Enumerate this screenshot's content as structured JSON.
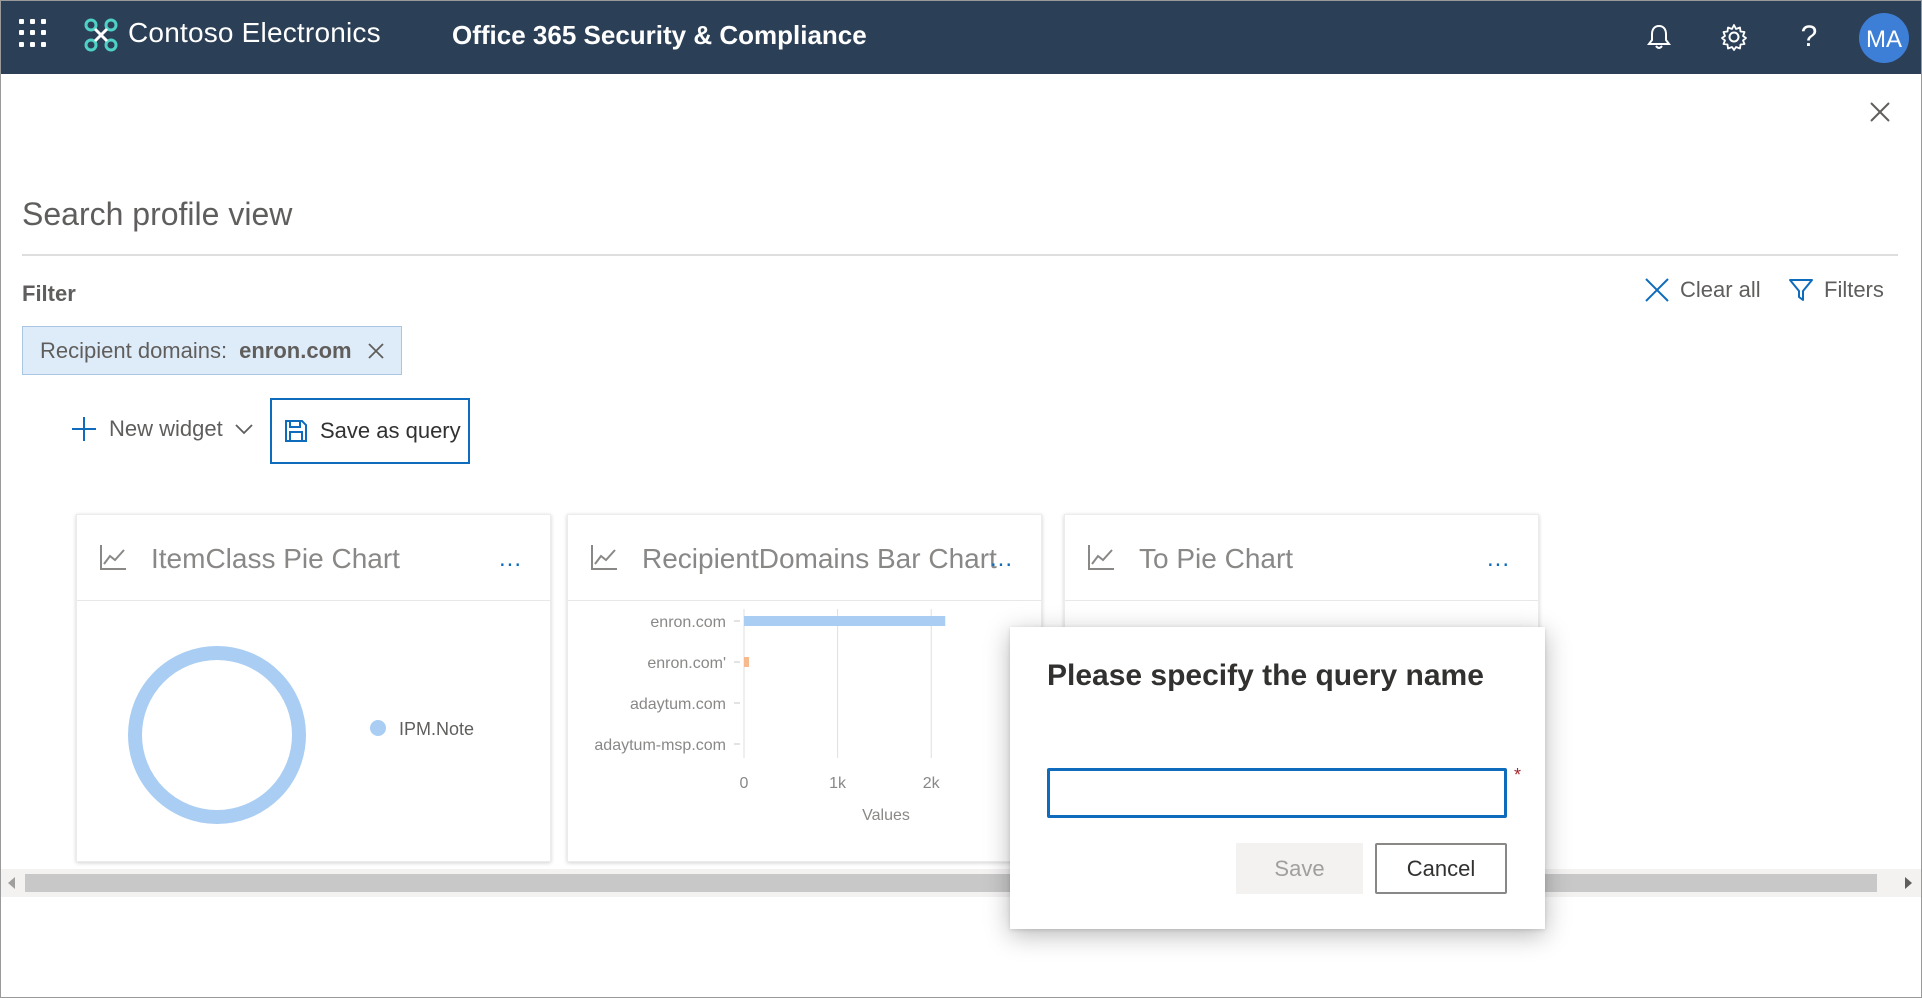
{
  "topbar": {
    "org_name": "Contoso Electronics",
    "app_title": "Office 365 Security & Compliance",
    "help_glyph": "?",
    "avatar_initials": "MA",
    "icons": [
      "app-launcher-icon",
      "bell-icon",
      "gear-icon",
      "help-icon"
    ]
  },
  "page": {
    "title": "Search profile view",
    "filter_label": "Filter",
    "clear_all_label": "Clear all",
    "filters_label": "Filters"
  },
  "filter_chip": {
    "label": "Recipient domains:",
    "value": "enron.com"
  },
  "toolbar": {
    "new_widget_label": "New widget",
    "save_query_label": "Save as query"
  },
  "widgets": [
    {
      "title": "ItemClass Pie Chart",
      "more": "..."
    },
    {
      "title": "RecipientDomains Bar Chart",
      "more": "..."
    },
    {
      "title": "To Pie Chart",
      "more": "..."
    }
  ],
  "chart_data": [
    {
      "type": "pie",
      "categories": [
        "IPM.Note"
      ],
      "values": [
        1
      ],
      "legend": "right"
    },
    {
      "type": "bar",
      "orientation": "horizontal",
      "categories": [
        "enron.com",
        "enron.com'",
        "adaytum.com",
        "adaytum-msp.com"
      ],
      "values": [
        2150,
        25,
        0,
        0
      ],
      "xlabel": "Values",
      "xticks": [
        "0",
        "1k",
        "2k"
      ],
      "xlim": [
        0,
        3000
      ],
      "grid": true,
      "bar_colors": [
        "#a9cdf3",
        "#f7b98e",
        "#a9cdf3",
        "#a9cdf3"
      ]
    }
  ],
  "dialog": {
    "title": "Please specify the query name",
    "input_value": "",
    "required_marker": "*",
    "save_label": "Save",
    "cancel_label": "Cancel"
  },
  "colors": {
    "topbar_bg": "#2b3f57",
    "accent": "#0f6cbd",
    "chip_bg": "#deecf9",
    "series_primary": "#a9cdf3",
    "series_secondary": "#f7b98e"
  }
}
